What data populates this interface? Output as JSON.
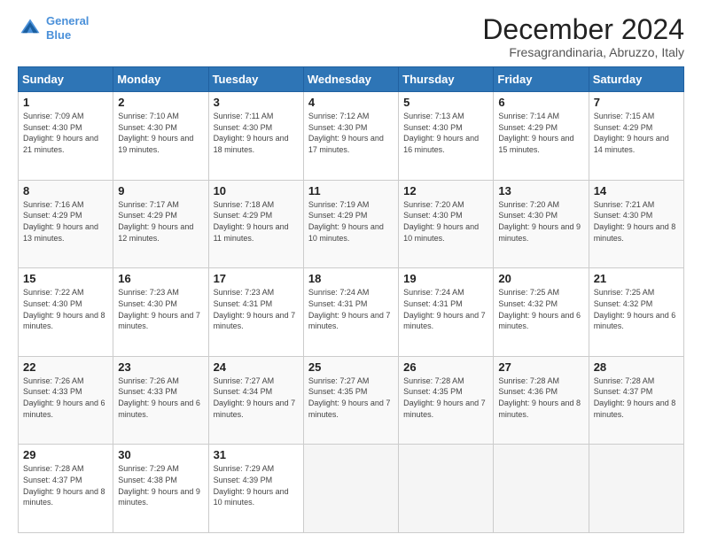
{
  "header": {
    "logo_line1": "General",
    "logo_line2": "Blue",
    "month_title": "December 2024",
    "location": "Fresagrandinaria, Abruzzo, Italy"
  },
  "weekdays": [
    "Sunday",
    "Monday",
    "Tuesday",
    "Wednesday",
    "Thursday",
    "Friday",
    "Saturday"
  ],
  "weeks": [
    [
      {
        "day": "1",
        "sunrise": "7:09 AM",
        "sunset": "4:30 PM",
        "daylight": "9 hours and 21 minutes."
      },
      {
        "day": "2",
        "sunrise": "7:10 AM",
        "sunset": "4:30 PM",
        "daylight": "9 hours and 19 minutes."
      },
      {
        "day": "3",
        "sunrise": "7:11 AM",
        "sunset": "4:30 PM",
        "daylight": "9 hours and 18 minutes."
      },
      {
        "day": "4",
        "sunrise": "7:12 AM",
        "sunset": "4:30 PM",
        "daylight": "9 hours and 17 minutes."
      },
      {
        "day": "5",
        "sunrise": "7:13 AM",
        "sunset": "4:30 PM",
        "daylight": "9 hours and 16 minutes."
      },
      {
        "day": "6",
        "sunrise": "7:14 AM",
        "sunset": "4:29 PM",
        "daylight": "9 hours and 15 minutes."
      },
      {
        "day": "7",
        "sunrise": "7:15 AM",
        "sunset": "4:29 PM",
        "daylight": "9 hours and 14 minutes."
      }
    ],
    [
      {
        "day": "8",
        "sunrise": "7:16 AM",
        "sunset": "4:29 PM",
        "daylight": "9 hours and 13 minutes."
      },
      {
        "day": "9",
        "sunrise": "7:17 AM",
        "sunset": "4:29 PM",
        "daylight": "9 hours and 12 minutes."
      },
      {
        "day": "10",
        "sunrise": "7:18 AM",
        "sunset": "4:29 PM",
        "daylight": "9 hours and 11 minutes."
      },
      {
        "day": "11",
        "sunrise": "7:19 AM",
        "sunset": "4:29 PM",
        "daylight": "9 hours and 10 minutes."
      },
      {
        "day": "12",
        "sunrise": "7:20 AM",
        "sunset": "4:30 PM",
        "daylight": "9 hours and 10 minutes."
      },
      {
        "day": "13",
        "sunrise": "7:20 AM",
        "sunset": "4:30 PM",
        "daylight": "9 hours and 9 minutes."
      },
      {
        "day": "14",
        "sunrise": "7:21 AM",
        "sunset": "4:30 PM",
        "daylight": "9 hours and 8 minutes."
      }
    ],
    [
      {
        "day": "15",
        "sunrise": "7:22 AM",
        "sunset": "4:30 PM",
        "daylight": "9 hours and 8 minutes."
      },
      {
        "day": "16",
        "sunrise": "7:23 AM",
        "sunset": "4:30 PM",
        "daylight": "9 hours and 7 minutes."
      },
      {
        "day": "17",
        "sunrise": "7:23 AM",
        "sunset": "4:31 PM",
        "daylight": "9 hours and 7 minutes."
      },
      {
        "day": "18",
        "sunrise": "7:24 AM",
        "sunset": "4:31 PM",
        "daylight": "9 hours and 7 minutes."
      },
      {
        "day": "19",
        "sunrise": "7:24 AM",
        "sunset": "4:31 PM",
        "daylight": "9 hours and 7 minutes."
      },
      {
        "day": "20",
        "sunrise": "7:25 AM",
        "sunset": "4:32 PM",
        "daylight": "9 hours and 6 minutes."
      },
      {
        "day": "21",
        "sunrise": "7:25 AM",
        "sunset": "4:32 PM",
        "daylight": "9 hours and 6 minutes."
      }
    ],
    [
      {
        "day": "22",
        "sunrise": "7:26 AM",
        "sunset": "4:33 PM",
        "daylight": "9 hours and 6 minutes."
      },
      {
        "day": "23",
        "sunrise": "7:26 AM",
        "sunset": "4:33 PM",
        "daylight": "9 hours and 6 minutes."
      },
      {
        "day": "24",
        "sunrise": "7:27 AM",
        "sunset": "4:34 PM",
        "daylight": "9 hours and 7 minutes."
      },
      {
        "day": "25",
        "sunrise": "7:27 AM",
        "sunset": "4:35 PM",
        "daylight": "9 hours and 7 minutes."
      },
      {
        "day": "26",
        "sunrise": "7:28 AM",
        "sunset": "4:35 PM",
        "daylight": "9 hours and 7 minutes."
      },
      {
        "day": "27",
        "sunrise": "7:28 AM",
        "sunset": "4:36 PM",
        "daylight": "9 hours and 8 minutes."
      },
      {
        "day": "28",
        "sunrise": "7:28 AM",
        "sunset": "4:37 PM",
        "daylight": "9 hours and 8 minutes."
      }
    ],
    [
      {
        "day": "29",
        "sunrise": "7:28 AM",
        "sunset": "4:37 PM",
        "daylight": "9 hours and 8 minutes."
      },
      {
        "day": "30",
        "sunrise": "7:29 AM",
        "sunset": "4:38 PM",
        "daylight": "9 hours and 9 minutes."
      },
      {
        "day": "31",
        "sunrise": "7:29 AM",
        "sunset": "4:39 PM",
        "daylight": "9 hours and 10 minutes."
      },
      null,
      null,
      null,
      null
    ]
  ]
}
